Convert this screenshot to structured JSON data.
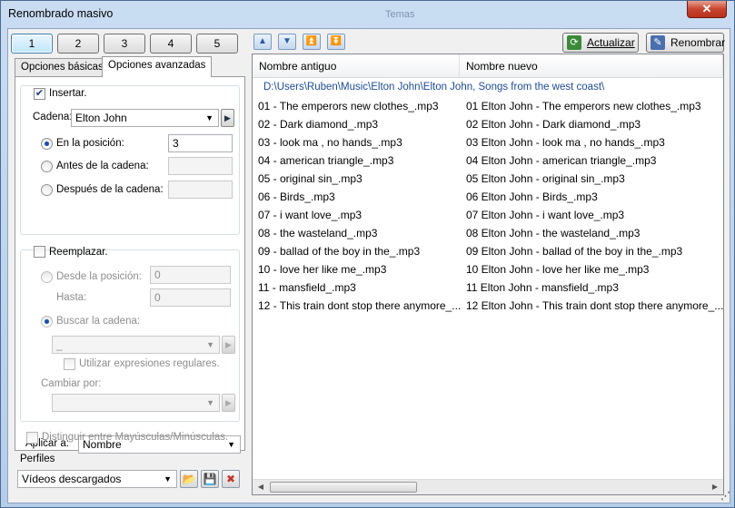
{
  "window": {
    "title": "Renombrado masivo",
    "bg_title": "Temas",
    "close": "✕"
  },
  "presets": [
    "1",
    "2",
    "3",
    "4",
    "5"
  ],
  "tabs": {
    "basic": "Opciones básicas",
    "advanced": "Opciones avanzadas"
  },
  "insert": {
    "checkbox_label": "Insertar.",
    "checked": true,
    "cadena_label": "Cadena:",
    "cadena_value": "Elton John",
    "pos_label": "En la posición:",
    "pos_value": "3",
    "before_label": "Antes de la cadena:",
    "after_label": "Después de la cadena:"
  },
  "replace": {
    "checkbox_label": "Reemplazar.",
    "from_label": "Desde la posición:",
    "from_value": "0",
    "to_label": "Hasta:",
    "to_value": "0",
    "search_label": "Buscar la cadena:",
    "search_value": "_",
    "regex_label": "Utilizar expresiones regulares.",
    "change_label": "Cambiar por:"
  },
  "apply": {
    "label": "Aplicar a:",
    "value": "Nombre"
  },
  "case_label": "Distinguir entre Mayúsculas/Minúsculas.",
  "profiles": {
    "label": "Perfiles",
    "value": "Vídeos descargados"
  },
  "toolbar": {
    "refresh": "Actualizar",
    "rename": "Renombrar"
  },
  "list": {
    "col_old": "Nombre antiguo",
    "col_new": "Nombre nuevo",
    "path": "D:\\Users\\Ruben\\Music\\Elton John\\Elton John, Songs from the west coast\\",
    "rows": [
      {
        "old": "01 - The emperors new clothes_.mp3",
        "new": "01 Elton John - The emperors new clothes_.mp3"
      },
      {
        "old": "02 - Dark diamond_.mp3",
        "new": "02 Elton John - Dark diamond_.mp3"
      },
      {
        "old": "03 - look ma , no hands_.mp3",
        "new": "03 Elton John - look ma , no hands_.mp3"
      },
      {
        "old": "04 - american triangle_.mp3",
        "new": "04 Elton John - american triangle_.mp3"
      },
      {
        "old": "05 - original sin_.mp3",
        "new": "05 Elton John - original sin_.mp3"
      },
      {
        "old": "06 - Birds_.mp3",
        "new": "06 Elton John - Birds_.mp3"
      },
      {
        "old": "07 - i want love_.mp3",
        "new": "07 Elton John - i want love_.mp3"
      },
      {
        "old": "08 - the wasteland_.mp3",
        "new": "08 Elton John - the wasteland_.mp3"
      },
      {
        "old": "09 - ballad of the boy in the_.mp3",
        "new": "09 Elton John - ballad of the boy in the_.mp3"
      },
      {
        "old": "10 - love her like me_.mp3",
        "new": "10 Elton John - love her like me_.mp3"
      },
      {
        "old": "11 - mansfield_.mp3",
        "new": "11 Elton John - mansfield_.mp3"
      },
      {
        "old": "12 - This train dont stop there anymore_...",
        "new": "12 Elton John - This train dont stop there anymore_..."
      }
    ]
  }
}
